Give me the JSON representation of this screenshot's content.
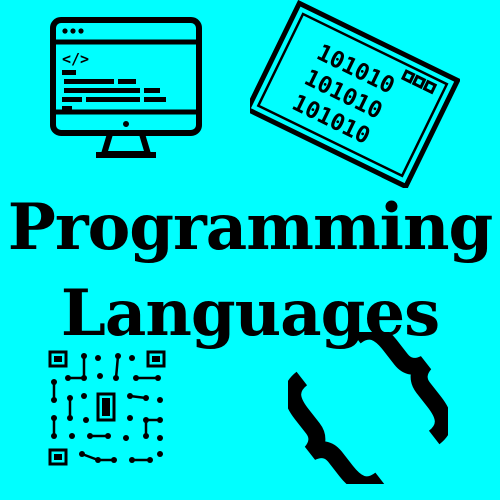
{
  "colors": {
    "background": "#00FFFF",
    "ink": "#000000"
  },
  "title": {
    "line1": "Programming",
    "line2": "Languages"
  },
  "code_window": {
    "tag": "</>"
  },
  "binary_window": {
    "lines": [
      "101010",
      "101010",
      "101010"
    ]
  },
  "icons": [
    "code-monitor-icon",
    "binary-window-icon",
    "qr-code-icon",
    "curly-brace-icon"
  ]
}
